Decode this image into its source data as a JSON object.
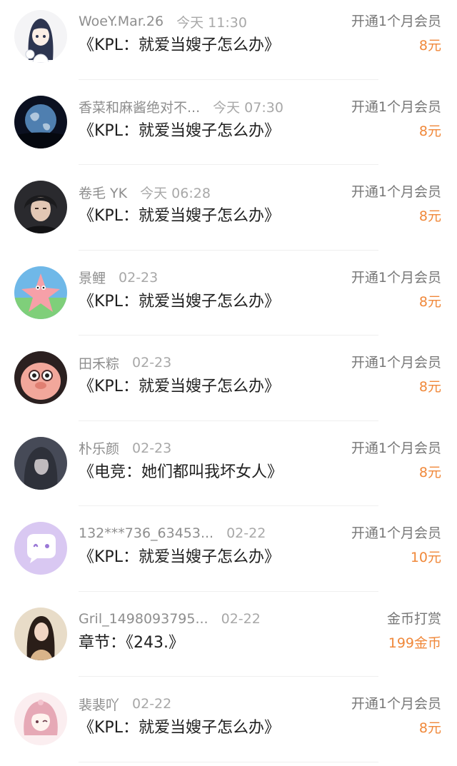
{
  "accent_color": "#f0883a",
  "records": [
    {
      "user": "WoeY.Mar.26",
      "time": "今天 11:30",
      "title": "《KPL：就爱当嫂子怎么办》",
      "type": "开通1个月会员",
      "amount": "8元",
      "avatar": "anime-girl-avatar"
    },
    {
      "user": "香菜和麻酱绝对不...",
      "time": "今天 07:30",
      "title": "《KPL：就爱当嫂子怎么办》",
      "type": "开通1个月会员",
      "amount": "8元",
      "avatar": "earth-avatar"
    },
    {
      "user": "卷毛 YK",
      "time": "今天 06:28",
      "title": "《KPL：就爱当嫂子怎么办》",
      "type": "开通1个月会员",
      "amount": "8元",
      "avatar": "boy-photo-avatar"
    },
    {
      "user": "景鲤",
      "time": "02-23",
      "title": "《KPL：就爱当嫂子怎么办》",
      "type": "开通1个月会员",
      "amount": "8元",
      "avatar": "patrick-star-avatar"
    },
    {
      "user": "田禾粽",
      "time": "02-23",
      "title": "《KPL：就爱当嫂子怎么办》",
      "type": "开通1个月会员",
      "amount": "8元",
      "avatar": "pink-pig-avatar"
    },
    {
      "user": "朴乐颜",
      "time": "02-23",
      "title": "《电竞：她们都叫我坏女人》",
      "type": "开通1个月会员",
      "amount": "8元",
      "avatar": "hooded-figure-avatar"
    },
    {
      "user": "132***736_63453...",
      "time": "02-22",
      "title": "《KPL：就爱当嫂子怎么办》",
      "type": "开通1个月会员",
      "amount": "10元",
      "avatar": "chat-bubble-avatar"
    },
    {
      "user": "Gril_1498093795...",
      "time": "02-22",
      "title": "章节：《243.》",
      "type": "金币打赏",
      "amount": "199金币",
      "avatar": "girl-photo-avatar"
    },
    {
      "user": "裴裴吖",
      "time": "02-22",
      "title": "《KPL：就爱当嫂子怎么办》",
      "type": "开通1个月会员",
      "amount": "8元",
      "avatar": "pink-anime-avatar"
    }
  ]
}
